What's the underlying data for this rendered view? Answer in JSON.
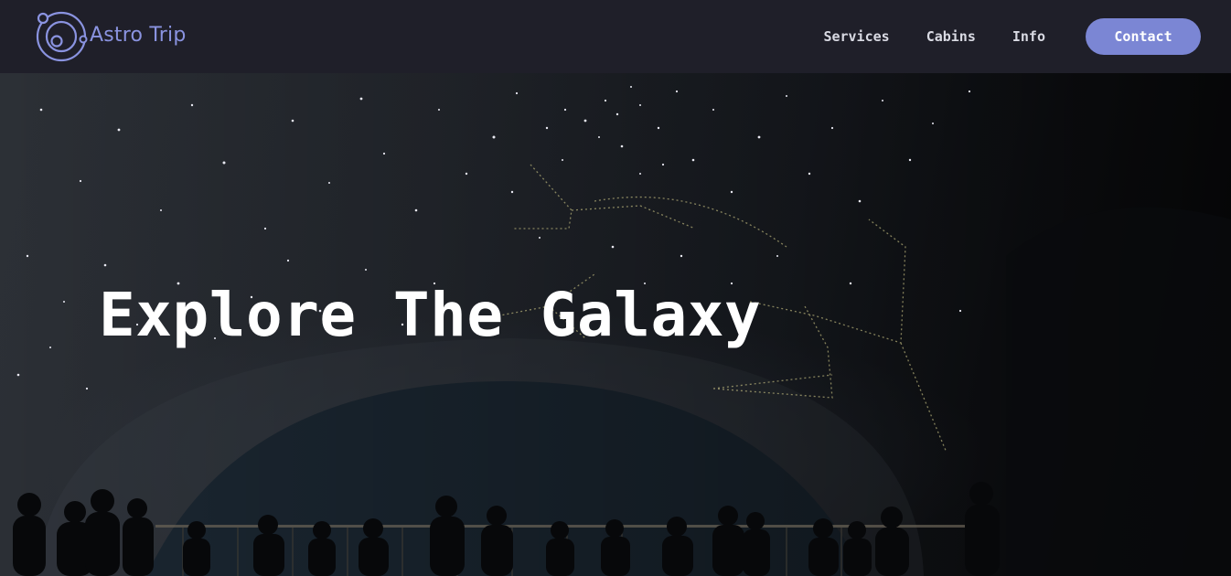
{
  "brand": {
    "name": "Astro Trip",
    "accent_color": "#7b86d4",
    "logo_icon": "orbit-logo-icon"
  },
  "nav": {
    "items": [
      {
        "label": "Services"
      },
      {
        "label": "Cabins"
      },
      {
        "label": "Info"
      }
    ],
    "contact_label": "Contact"
  },
  "hero": {
    "title": "Explore The Galaxy",
    "background": "planetarium-night-sky-image"
  }
}
